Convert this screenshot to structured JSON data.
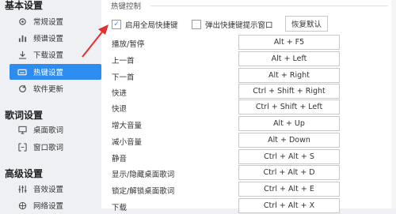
{
  "sidebar": {
    "sections": [
      {
        "title": "基本设置"
      },
      {
        "title": "歌词设置"
      },
      {
        "title": "高级设置"
      }
    ],
    "items": [
      {
        "label": "常规设置",
        "icon": "gear-icon"
      },
      {
        "label": "频谱设置",
        "icon": "spectrum-icon"
      },
      {
        "label": "下载设置",
        "icon": "download-icon"
      },
      {
        "label": "热键设置",
        "icon": "keyboard-icon"
      },
      {
        "label": "软件更新",
        "icon": "refresh-icon"
      },
      {
        "label": "桌面歌词",
        "icon": "desktop-lyrics-icon"
      },
      {
        "label": "窗口歌词",
        "icon": "window-lyrics-icon"
      },
      {
        "label": "音效设置",
        "icon": "equalizer-icon"
      },
      {
        "label": "网络设置",
        "icon": "network-icon"
      }
    ]
  },
  "main": {
    "section_title": "热键控制",
    "enable_global": {
      "label": "启用全局快捷键",
      "checked": true
    },
    "show_tip": {
      "label": "弹出快捷键提示窗口",
      "checked": false
    },
    "restore_label": "恢复默认",
    "hotkeys": [
      {
        "action": "播放/暂停",
        "key": "Alt + F5"
      },
      {
        "action": "上一首",
        "key": "Alt + Left"
      },
      {
        "action": "下一首",
        "key": "Alt + Right"
      },
      {
        "action": "快进",
        "key": "Ctrl + Shift + Right"
      },
      {
        "action": "快退",
        "key": "Ctrl + Shift + Left"
      },
      {
        "action": "增大音量",
        "key": "Alt + Up"
      },
      {
        "action": "减小音量",
        "key": "Alt + Down"
      },
      {
        "action": "静音",
        "key": "Ctrl + Alt + S"
      },
      {
        "action": "显示/隐藏桌面歌词",
        "key": "Ctrl + Alt + D"
      },
      {
        "action": "锁定/解锁桌面歌词",
        "key": "Ctrl + Alt + E"
      },
      {
        "action": "下载",
        "key": "Ctrl + Alt + X"
      }
    ]
  },
  "colors": {
    "accent": "#2d8cf0",
    "annotation": "#e03030"
  }
}
